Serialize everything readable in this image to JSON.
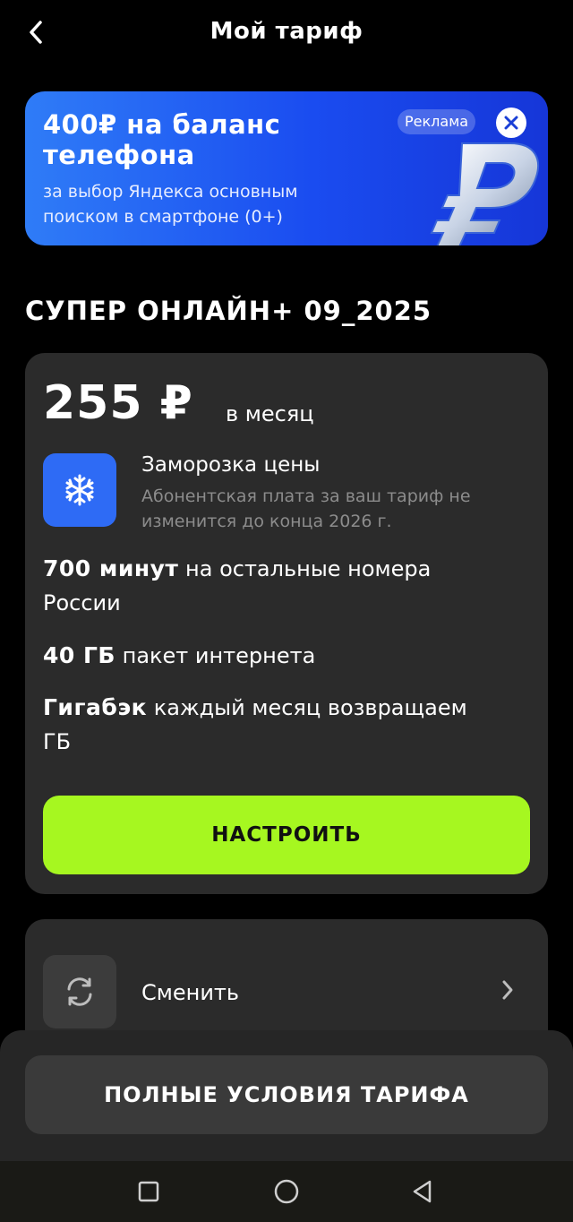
{
  "header": {
    "title": "Мой тариф",
    "back_icon": "chevron-left-icon"
  },
  "ad": {
    "title_line1": "400₽ на баланс",
    "title_line2": "телефона",
    "desc_line1": "за выбор Яндекса основным",
    "desc_line2": "поиском в смартфоне (0+)",
    "tag": "Реклама",
    "close_icon": "close-icon",
    "image_icon": "ruble-sign-icon",
    "colors": {
      "bg_start": "#2f7cf7",
      "bg_end": "#1636d8"
    }
  },
  "tariff": {
    "name": "СУПЕР ОНЛАЙН+ 09_2025",
    "price": "255 ₽",
    "price_unit": "в месяц",
    "freeze": {
      "icon": "snowflake-icon",
      "title": "Заморозка цены",
      "desc_line1": "Абонентская плата за ваш тариф не",
      "desc_line2": "изменится до конца 2026 г."
    },
    "features": [
      {
        "bold": "700 минут",
        "text": "на остальные номера",
        "text2": "России"
      },
      {
        "bold": "40 ГБ",
        "text": "пакет интернета"
      },
      {
        "bold": "Гигабэк",
        "text": "каждый месяц возвращаем",
        "text2": "ГБ"
      }
    ],
    "cta_label": "НАСТРОИТЬ",
    "colors": {
      "card_bg": "#2b2b2b",
      "cta_bg": "#a6f720",
      "freeze_bg": "#2e6bf5"
    }
  },
  "change": {
    "icon": "refresh-icon",
    "label": "Сменить",
    "chevron_icon": "chevron-right-icon"
  },
  "terms_button": "ПОЛНЫЕ УСЛОВИЯ ТАРИФА",
  "system_nav": {
    "recents_icon": "square-icon",
    "home_icon": "circle-icon",
    "back_icon": "triangle-back-icon"
  }
}
